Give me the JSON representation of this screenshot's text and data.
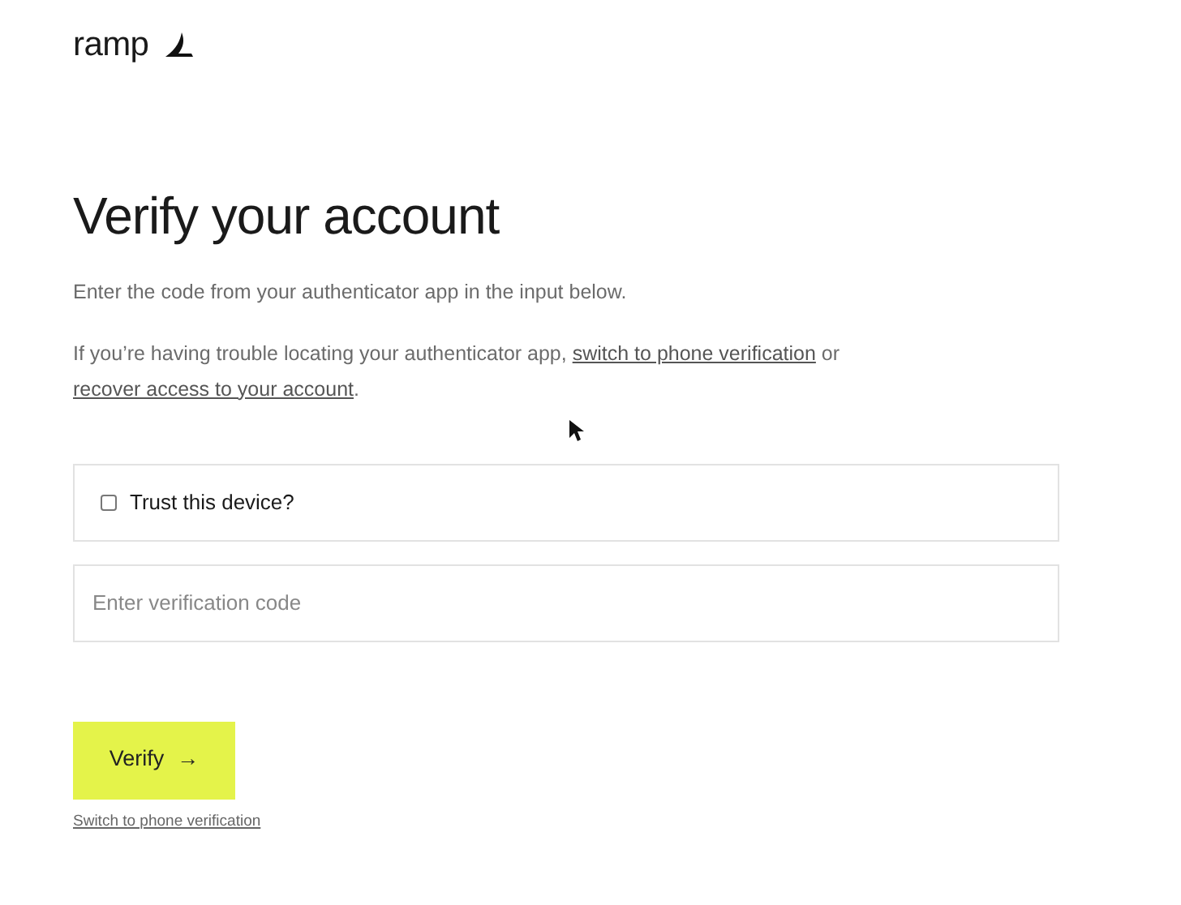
{
  "logo": {
    "text": "ramp"
  },
  "heading": "Verify your account",
  "intro": "Enter the code from your authenticator app in the input below.",
  "help": {
    "before": "If you’re having trouble locating your authenticator app, ",
    "link_1": "switch to phone verification",
    "middle": " or ",
    "link_2": "recover access to your account",
    "after": "."
  },
  "trust_device": {
    "label": "Trust this device?",
    "checked": false
  },
  "code_field": {
    "placeholder": "Enter verification code"
  },
  "verify_button": {
    "label": "Verify",
    "arrow": "→"
  },
  "footer_link": "Switch to phone verification"
}
